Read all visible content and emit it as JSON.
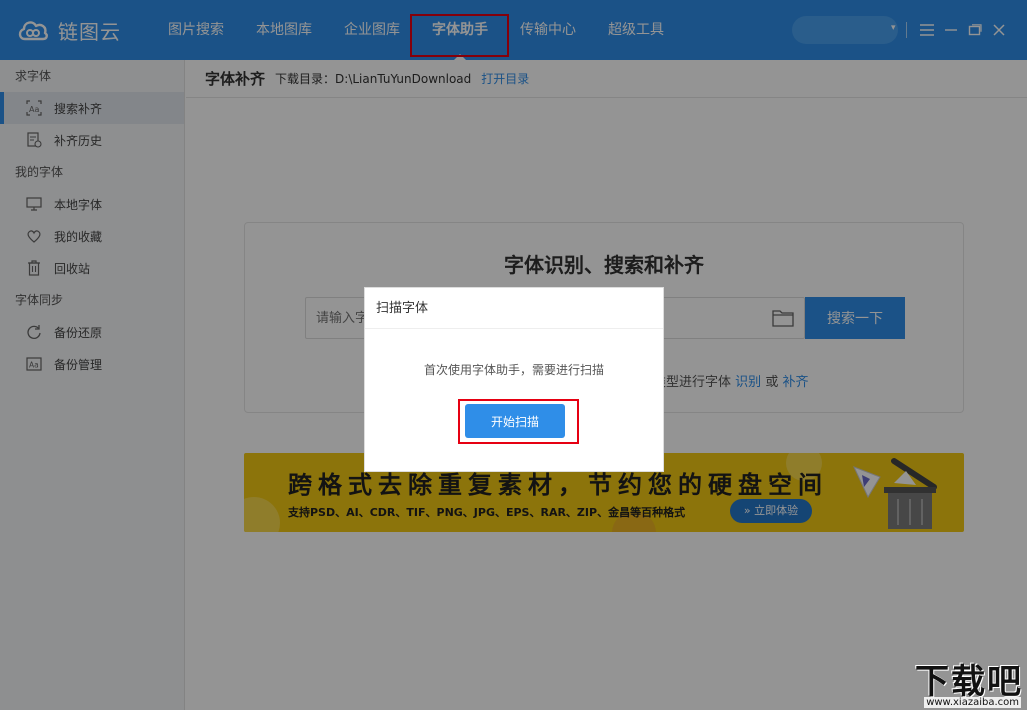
{
  "app": {
    "name": "链图云",
    "colors": {
      "brand": "#2f8ee8",
      "highlight": "#e60012",
      "banner": "#f2c814"
    }
  },
  "nav": {
    "items": [
      {
        "label": "图片搜索",
        "active": false
      },
      {
        "label": "本地图库",
        "active": false
      },
      {
        "label": "企业图库",
        "active": false
      },
      {
        "label": "字体助手",
        "active": true
      },
      {
        "label": "传输中心",
        "active": false
      },
      {
        "label": "超级工具",
        "active": false
      }
    ]
  },
  "window_controls": {
    "caret": "▾",
    "icons": [
      "menu-icon",
      "minimize-icon",
      "maximize-icon",
      "close-icon"
    ]
  },
  "sidebar": {
    "groups": [
      {
        "label": "求字体",
        "items": [
          {
            "label": "搜索补齐",
            "icon": "font-search-icon",
            "active": true
          },
          {
            "label": "补齐历史",
            "icon": "history-doc-icon",
            "active": false
          }
        ]
      },
      {
        "label": "我的字体",
        "items": [
          {
            "label": "本地字体",
            "icon": "monitor-icon",
            "active": false
          },
          {
            "label": "我的收藏",
            "icon": "heart-icon",
            "active": false
          },
          {
            "label": "回收站",
            "icon": "trash-icon",
            "active": false
          }
        ]
      },
      {
        "label": "字体同步",
        "items": [
          {
            "label": "备份还原",
            "icon": "refresh-icon",
            "active": false
          },
          {
            "label": "备份管理",
            "icon": "font-box-icon",
            "active": false
          }
        ]
      }
    ]
  },
  "header": {
    "title": "字体补齐",
    "dir_label": "下载目录：",
    "dir_path": "D:\\LianTuYunDownload",
    "open_dir": "打开目录"
  },
  "card": {
    "title": "字体识别、搜索和补齐",
    "search_placeholder": "请输入字体名称",
    "search_button": "搜索一下",
    "hint_prefix": "类型进行字体",
    "hint_link1": "识别",
    "hint_or": "或",
    "hint_link2": "补齐"
  },
  "banner": {
    "line1": "跨格式去除重复素材，节约您的硬盘空间",
    "line2": "支持PSD、AI、CDR、TIF、PNG、JPG、EPS、RAR、ZIP、金昌等百种格式",
    "button": "» 立即体验"
  },
  "dialog": {
    "title": "扫描字体",
    "message": "首次使用字体助手，需要进行扫描",
    "button": "开始扫描"
  },
  "watermark": {
    "main": "下载吧",
    "sub": "www.xiazaiba.com"
  }
}
